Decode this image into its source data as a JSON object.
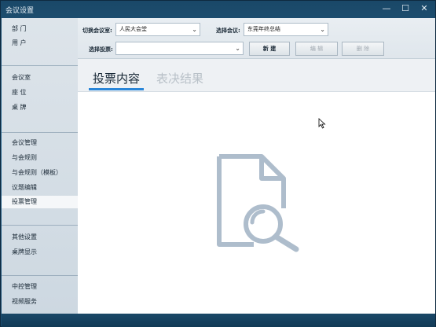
{
  "window": {
    "title": "会议设置",
    "controls": {
      "minimize": "—",
      "maximize": "☐",
      "close": "✕"
    }
  },
  "sidebar": {
    "group1": [
      "部 门",
      "用 户"
    ],
    "group2": [
      "会议室",
      "座 位",
      "桌 牌"
    ],
    "group3": [
      "会议管理",
      "与会规则",
      "与会规则（模板）",
      "议题编辑",
      "投票管理"
    ],
    "group4": [
      "其他设置",
      "桌牌显示"
    ],
    "group5": [
      "中控管理",
      "视频服务"
    ],
    "active": "投票管理"
  },
  "toolbar": {
    "switch_room_label": "切换会议室:",
    "switch_room_value": "人民大会堂",
    "select_meeting_label": "选择会议:",
    "select_meeting_value": "东莞年终总结",
    "select_vote_label": "选择投票:",
    "select_vote_value": "",
    "new_label": "新 建",
    "edit_label": "编 辑",
    "delete_label": "删 除"
  },
  "tabs": {
    "vote_content": "投票内容",
    "vote_result": "表决结果"
  },
  "colors": {
    "accent": "#2a86d8",
    "icon": "#aebdcc"
  },
  "icons": {
    "empty_state": "document-search-icon"
  }
}
